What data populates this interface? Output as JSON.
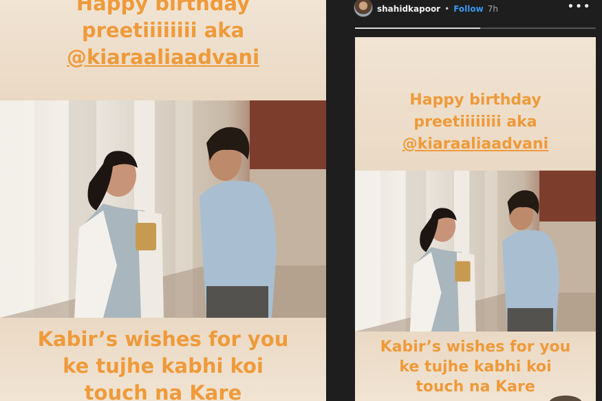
{
  "story_caption_top": {
    "line1": "Happy birthday",
    "line2": "preetiiiiiiii aka",
    "mention": "@kiaraaliaadvani"
  },
  "story_caption_bottom": {
    "line1": "Kabir’s wishes for you",
    "line2": "ke tujhe kabhi koi",
    "line3": "touch na Kare"
  },
  "header": {
    "username": "shahidkapoor",
    "separator": "•",
    "follow_label": "Follow",
    "time": "7h",
    "more_label": "•••"
  },
  "progress": {
    "value": 0.52
  },
  "colors": {
    "caption": "#ef9a3a",
    "story_bg": "#eedfcc",
    "follow": "#3897f0",
    "panel_bg": "#1e1e1e"
  },
  "icons": {
    "more": "more-options-icon",
    "avatar": "profile-avatar"
  }
}
